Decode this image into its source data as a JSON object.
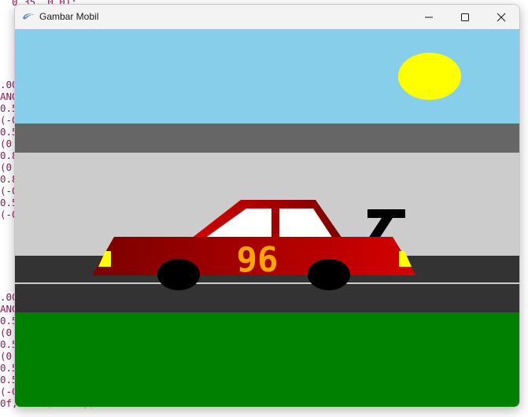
{
  "window": {
    "title": "Gambar Mobil",
    "controls": [
      "minimize",
      "maximize",
      "close"
    ]
  },
  "background_code": {
    "lines": [
      {
        "text": "  0.35, 0.0);",
        "row": 0
      },
      {
        "text": ".00",
        "row": 7
      },
      {
        "text": "ANG",
        "row": 8
      },
      {
        "text": "0.5",
        "row": 9
      },
      {
        "text": "(-0",
        "row": 10
      },
      {
        "text": "0.5",
        "row": 11
      },
      {
        "text": "(0.",
        "row": 12
      },
      {
        "text": "0.8",
        "row": 13
      },
      {
        "text": "(0.",
        "row": 14
      },
      {
        "text": "0.8",
        "row": 15
      },
      {
        "text": "(-0",
        "row": 16
      },
      {
        "text": "0.5",
        "row": 17
      },
      {
        "text": "(-0",
        "row": 18
      },
      {
        "text": ".00",
        "row": 25
      },
      {
        "text": "ANG",
        "row": 26
      },
      {
        "text": "0.5",
        "row": 27
      },
      {
        "text": "(0.",
        "row": 28
      },
      {
        "text": "0.5",
        "row": 29
      },
      {
        "text": "(0.",
        "row": 30
      },
      {
        "text": "0.5",
        "row": 31
      },
      {
        "text": "0.5",
        "row": 32
      },
      {
        "text": "(-0",
        "row": 33
      },
      {
        "text": "0f, 0.0f, 0.0f);",
        "row": 34
      }
    ]
  },
  "scene": {
    "car_number": "96",
    "colors": {
      "sky": "#87ceeb",
      "sun": "#ffff00",
      "wall": "#666666",
      "track": "#cccccc",
      "asphalt": "#333333",
      "lane_line": "#ffffff",
      "grass": "#008000",
      "car_body_dark": "#7a0000",
      "car_body_light": "#d40000",
      "window": "#ffffff",
      "tire": "#000000",
      "number": "#ffa500",
      "light": "#ffff00",
      "spoiler": "#000000"
    }
  }
}
